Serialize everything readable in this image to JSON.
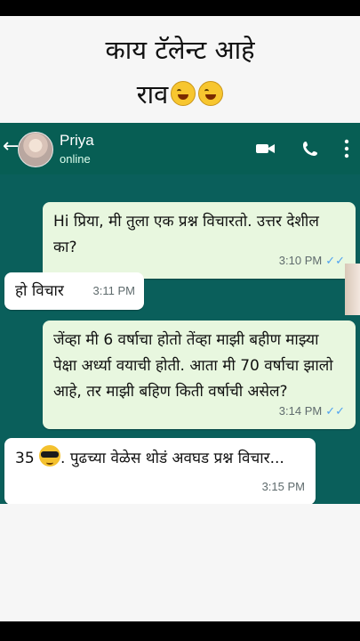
{
  "captions": {
    "line1": "काय टॅलेन्ट आहे",
    "line2": "राव"
  },
  "contact": {
    "name": "Priya",
    "status": "online"
  },
  "messages": [
    {
      "direction": "sent",
      "text": "Hi प्रिया, मी तुला एक प्रश्न विचारतो. उत्तर देशील का?",
      "time": "3:10 PM"
    },
    {
      "direction": "received",
      "text": "हो विचार",
      "time": "3:11 PM"
    },
    {
      "direction": "sent",
      "text": "जेंव्हा मी 6 वर्षाचा होतो तेंव्हा माझी बहीण माझ्या पेक्षा अर्ध्या वयाची होती. आता मी 70 वर्षाचा झालो आहे, तर माझी बहिण किती वर्षाची असेल?",
      "time": "3:14 PM"
    },
    {
      "direction": "received",
      "text_prefix": "35",
      "text": ". पुढच्या वेळेस थोडं अवघड प्रश्न विचार...",
      "time": "3:15 PM"
    }
  ],
  "icons": [
    "back-arrow-icon",
    "video-call-icon",
    "phone-call-icon",
    "menu-dots-icon",
    "read-receipt-icon",
    "rolling-laughing-emoji-icon",
    "sunglasses-emoji-icon"
  ],
  "colors": {
    "header": "#075e54",
    "chat_background": "#0a5f5b",
    "sent_bubble": "#e8f7df",
    "received_bubble": "#ffffff",
    "read_tick": "#4fa3f0"
  }
}
